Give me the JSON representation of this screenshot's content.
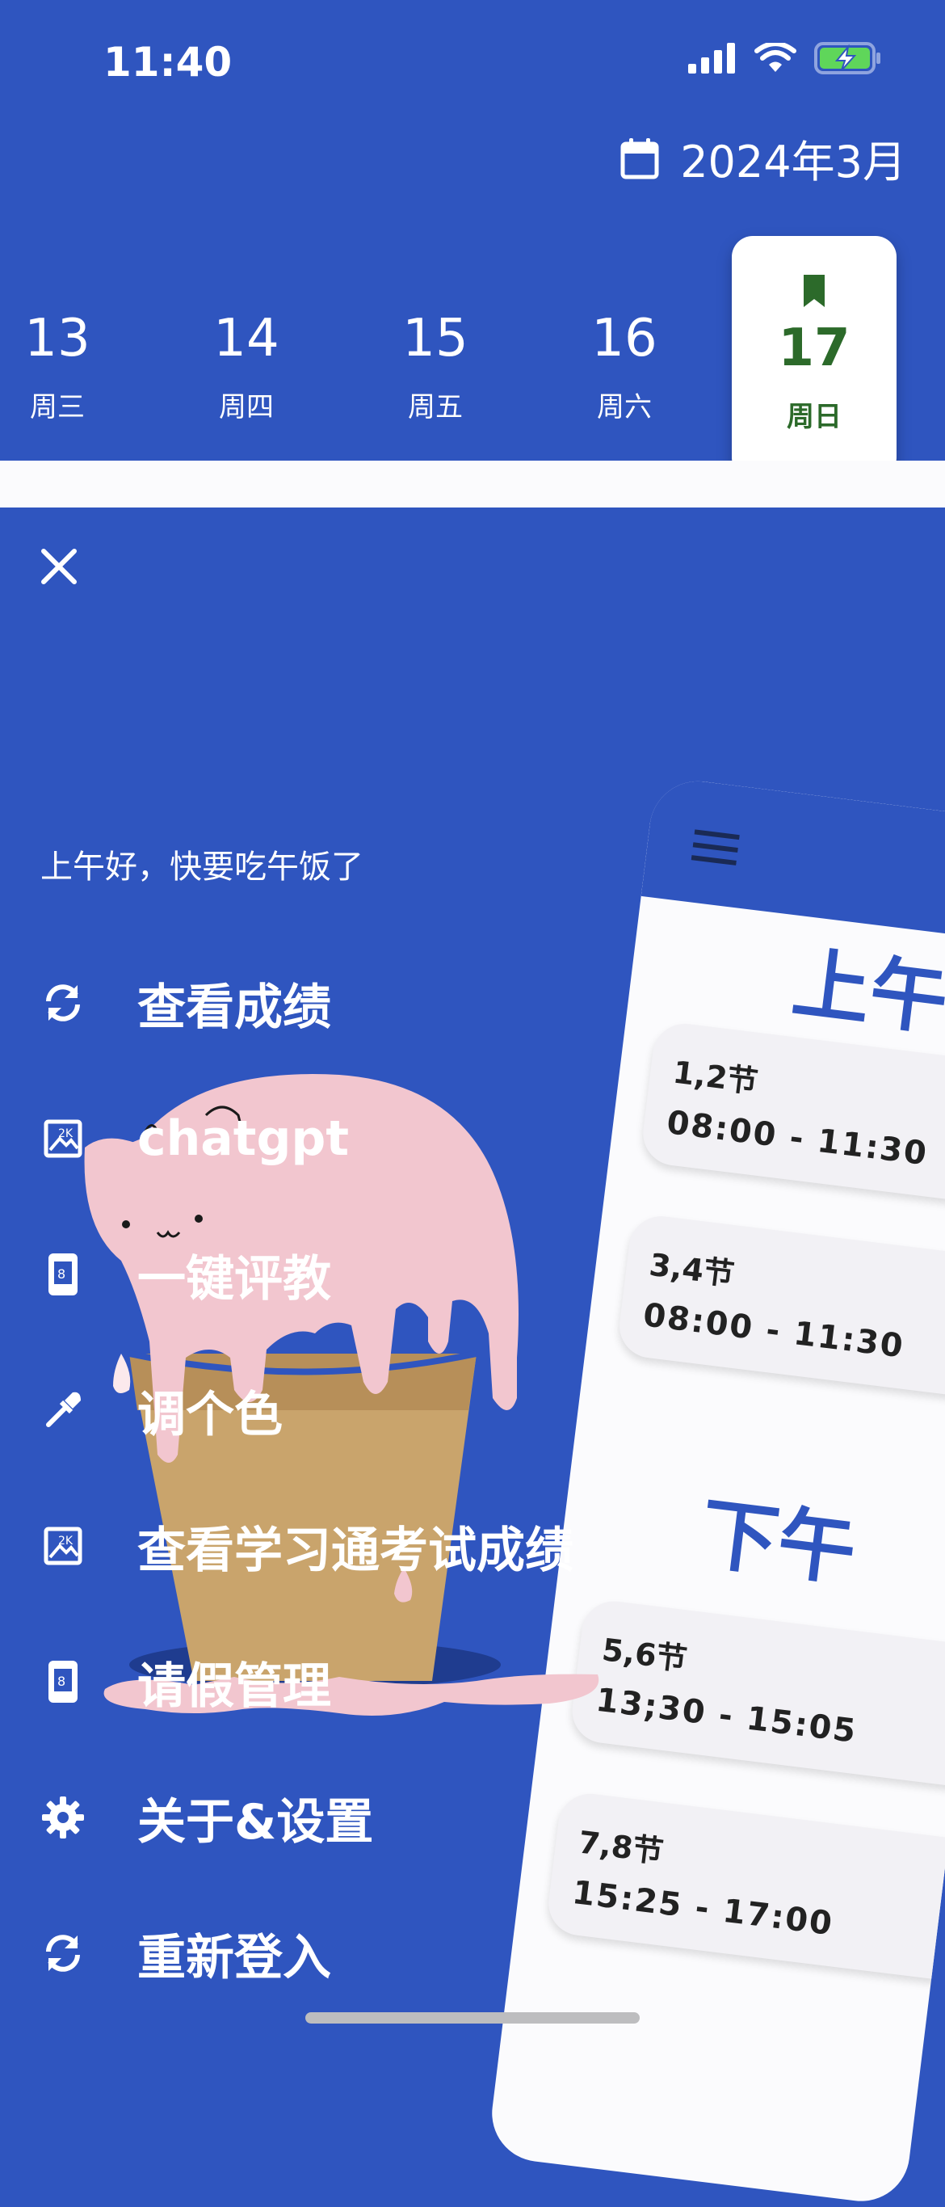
{
  "status_bar": {
    "time": "11:40"
  },
  "header": {
    "month_label": "2024年3月"
  },
  "days": [
    {
      "num": "13",
      "weekday": "周三"
    },
    {
      "num": "14",
      "weekday": "周四"
    },
    {
      "num": "15",
      "weekday": "周五"
    },
    {
      "num": "16",
      "weekday": "周六"
    }
  ],
  "selected_day": {
    "num": "17",
    "weekday": "周日"
  },
  "drawer": {
    "greeting": "上午好，快要吃午饭了",
    "items": [
      {
        "label": "查看成绩",
        "icon": "refresh-icon"
      },
      {
        "label": "chatgpt",
        "icon": "image-icon"
      },
      {
        "label": "一键评教",
        "icon": "phone-icon"
      },
      {
        "label": "调个色",
        "icon": "eyedropper-icon"
      },
      {
        "label": "查看学习通考试成绩",
        "icon": "image-icon"
      },
      {
        "label": "请假管理",
        "icon": "phone-icon"
      },
      {
        "label": "关于&设置",
        "icon": "gear-icon"
      },
      {
        "label": "重新登入",
        "icon": "refresh-icon"
      }
    ]
  },
  "preview": {
    "morning_title": "上午",
    "afternoon_title": "下午",
    "slots": [
      {
        "period": "1,2节",
        "time": "08:00 - 11:30"
      },
      {
        "period": "3,4节",
        "time": "08:00 - 11:30"
      },
      {
        "period": "5,6节",
        "time": "13;30 - 15:05"
      },
      {
        "period": "7,8节",
        "time": "15:25 - 17:00"
      }
    ]
  },
  "colors": {
    "primary": "#2f55bf",
    "selected_day_text": "#2c6a2a",
    "ice_cream_pink": "#f2c6cf",
    "cone": "#c9a46c"
  }
}
